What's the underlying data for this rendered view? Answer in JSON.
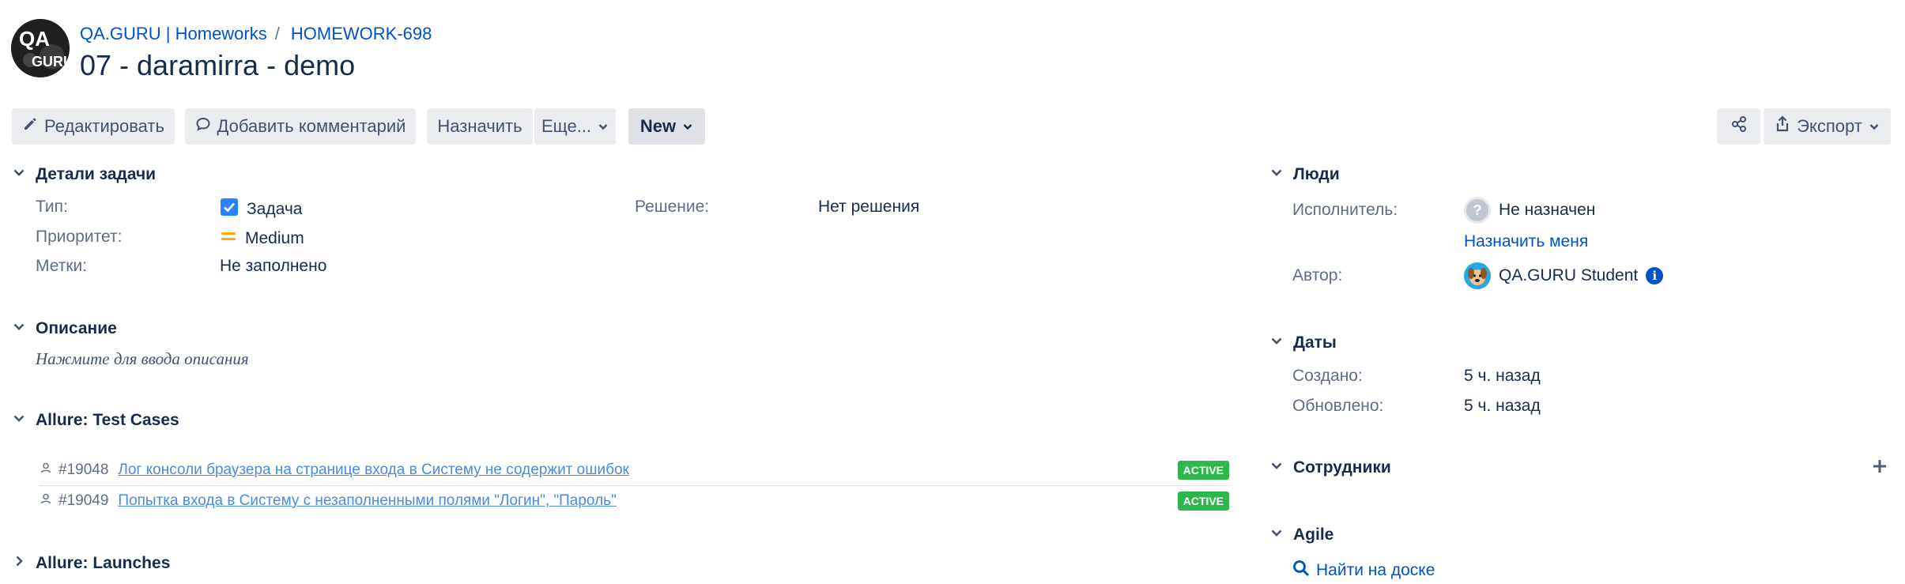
{
  "breadcrumb": {
    "project": "QA.GURU | Homeworks",
    "issue_key": "HOMEWORK-698",
    "separator": "/"
  },
  "issue": {
    "title": "07 - daramirra - demo"
  },
  "logo": {
    "text_top": "QA",
    "text_bottom": "GURU"
  },
  "toolbar": {
    "edit": "Редактировать",
    "comment": "Добавить комментарий",
    "assign": "Назначить",
    "more": "Еще...",
    "status": "New",
    "export": "Экспорт"
  },
  "details": {
    "heading": "Детали задачи",
    "type_label": "Тип:",
    "type_value": "Задача",
    "priority_label": "Приоритет:",
    "priority_value": "Medium",
    "labels_label": "Метки:",
    "labels_value": "Не заполнено",
    "resolution_label": "Решение:",
    "resolution_value": "Нет решения"
  },
  "description": {
    "heading": "Описание",
    "placeholder": "Нажмите для ввода описания"
  },
  "allure_cases": {
    "heading": "Allure: Test Cases",
    "items": [
      {
        "id": "#19048",
        "name": "Лог консоли браузера на странице входа в Систему не содержит ошибок",
        "status": "ACTIVE"
      },
      {
        "id": "#19049",
        "name": "Попытка входа в Систему с незаполненными полями \"Логин\", \"Пароль\"",
        "status": "ACTIVE"
      }
    ]
  },
  "allure_launches": {
    "heading": "Allure: Launches"
  },
  "people": {
    "heading": "Люди",
    "assignee_label": "Исполнитель:",
    "assignee_value": "Не назначен",
    "assign_me": "Назначить меня",
    "reporter_label": "Автор:",
    "reporter_value": "QA.GURU Student"
  },
  "dates": {
    "heading": "Даты",
    "created_label": "Создано:",
    "created_value": "5 ч. назад",
    "updated_label": "Обновлено:",
    "updated_value": "5 ч. назад"
  },
  "employees": {
    "heading": "Сотрудники"
  },
  "agile": {
    "heading": "Agile",
    "find_on_board": "Найти на доске"
  },
  "colors": {
    "link": "#0052cc",
    "active_badge": "#2eb84c",
    "priority_medium": "#ffab00",
    "checkbox": "#2684ff"
  }
}
